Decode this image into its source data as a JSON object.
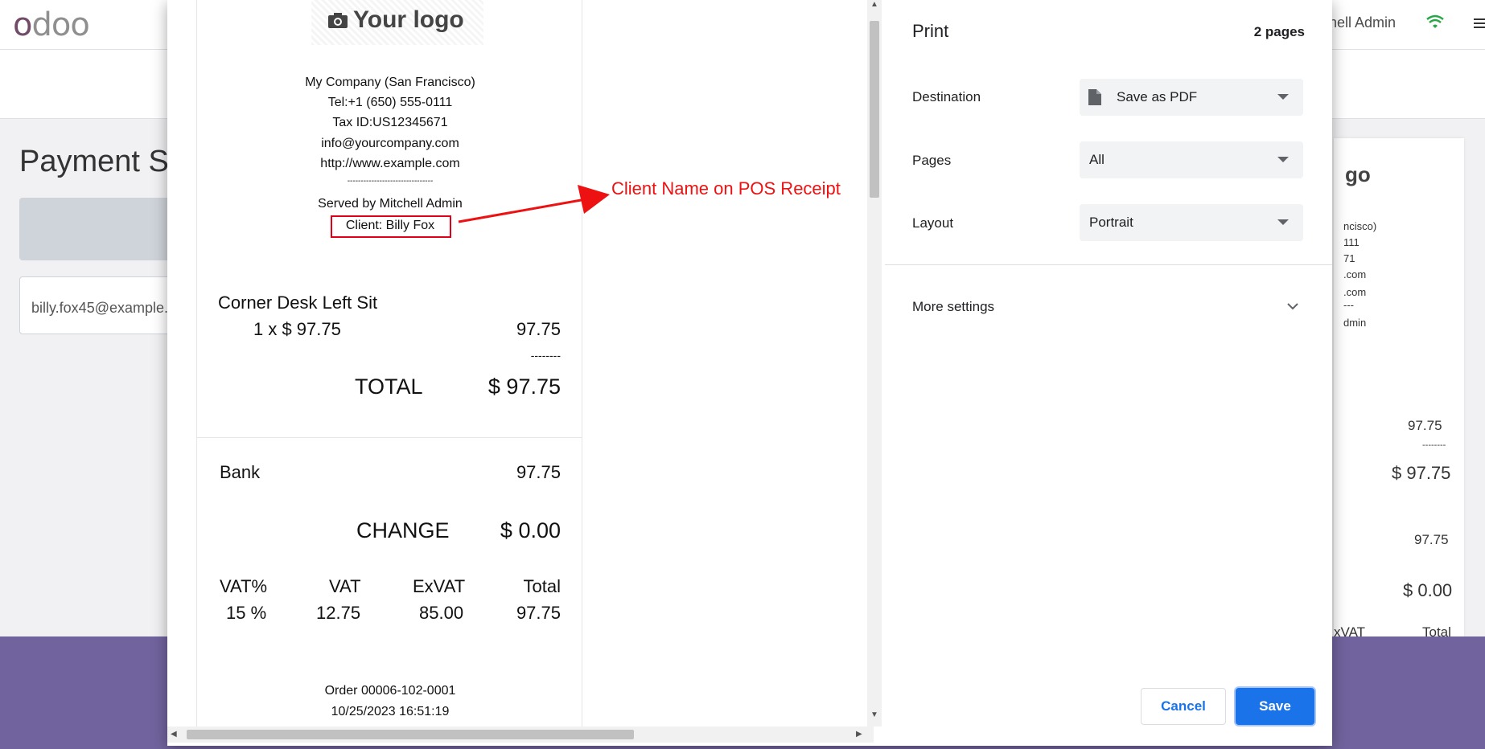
{
  "app": {
    "logo_first": "o",
    "logo_rest": "doo",
    "user": "hell Admin",
    "page_title": "Payment Su",
    "email_field_value": "billy.fox45@example."
  },
  "receipt": {
    "logo_text": "Your logo",
    "company": "My Company (San Francisco)",
    "tel": "Tel:+1 (650) 555-0111",
    "tax_id": "Tax ID:US12345671",
    "email": "info@yourcompany.com",
    "website": "http://www.example.com",
    "separator": "--------------------------------",
    "served_by": "Served by Mitchell Admin",
    "client": "Client: Billy Fox",
    "product_name": "Corner Desk Left Sit",
    "product_qty_price": "1 x $ 97.75",
    "product_total": "97.75",
    "dashes": "--------",
    "total_label": "TOTAL",
    "total_value": "$ 97.75",
    "payment_method": "Bank",
    "payment_amount": "97.75",
    "change_label": "CHANGE",
    "change_value": "$ 0.00",
    "tax_table": {
      "headers": [
        "VAT%",
        "VAT",
        "ExVAT",
        "Total"
      ],
      "row": [
        "15 %",
        "12.75",
        "85.00",
        "97.75"
      ]
    },
    "order": "Order 00006-102-0001",
    "datetime": "10/25/2023 16:51:19"
  },
  "annotation": "Client Name on POS Receipt",
  "bg_receipt": {
    "logo": "go",
    "lines": [
      "ncisco)",
      "111",
      "71",
      ".com",
      ".com",
      "---",
      "dmin"
    ],
    "amount1": "97.75",
    "dashes": "--------",
    "total": "$ 97.75",
    "amount2": "97.75",
    "change": "$ 0.00",
    "col1": "xVAT",
    "col2": "Total"
  },
  "print_dialog": {
    "title": "Print",
    "page_count": "2 pages",
    "destination_label": "Destination",
    "destination_value": "Save as PDF",
    "pages_label": "Pages",
    "pages_value": "All",
    "layout_label": "Layout",
    "layout_value": "Portrait",
    "more_settings": "More settings",
    "cancel": "Cancel",
    "save": "Save"
  },
  "colors": {
    "odoo_purple": "#714B67",
    "footer_purple": "#71639e",
    "annotation_red": "#ee1111",
    "save_blue": "#1a73e8"
  }
}
